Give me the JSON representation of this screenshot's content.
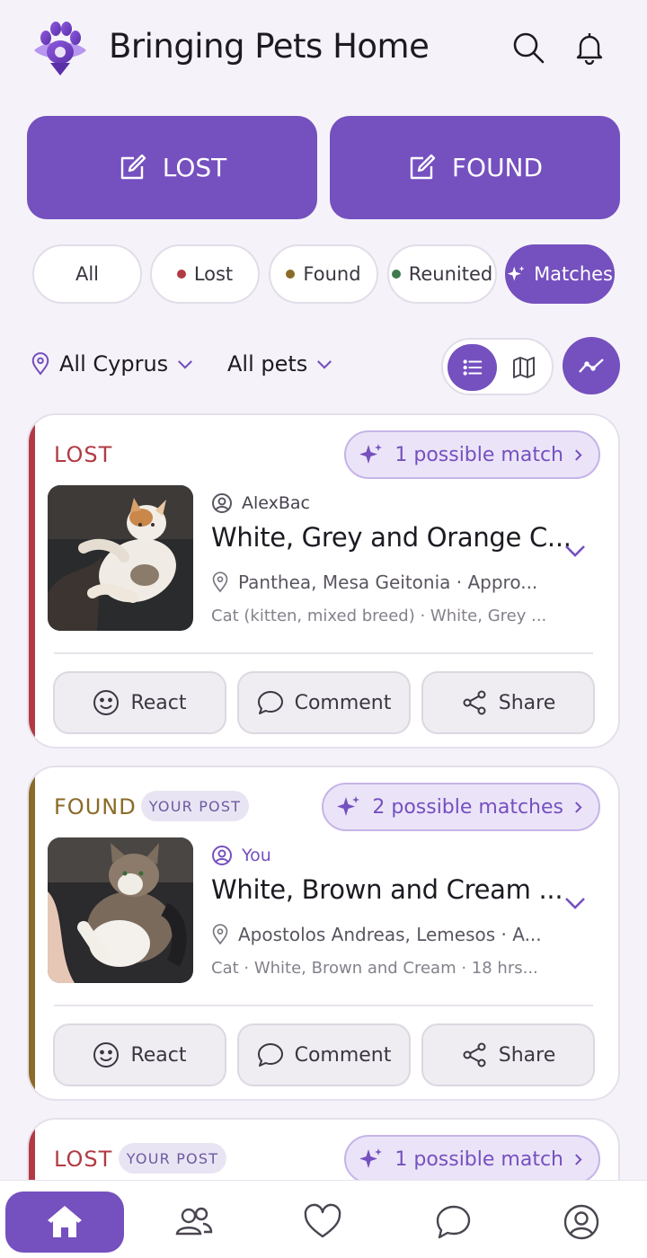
{
  "app": {
    "title": "Bringing Pets Home"
  },
  "header": {
    "icons": [
      "search-icon",
      "bell-icon"
    ]
  },
  "actions": {
    "lost_label": "LOST",
    "found_label": "FOUND"
  },
  "status_filters": [
    {
      "label": "All",
      "dot_color": null
    },
    {
      "label": "Lost",
      "dot_color": "#b23a44"
    },
    {
      "label": "Found",
      "dot_color": "#8a6b28"
    },
    {
      "label": "Reunited",
      "dot_color": "#3c7a4e"
    },
    {
      "label": "Matches",
      "dot_color": null,
      "active": true
    }
  ],
  "filters": {
    "location": "All Cyprus",
    "pets": "All pets",
    "view_mode": "list"
  },
  "colors": {
    "accent": "#7550bf",
    "lost": "#b23a44",
    "found": "#8a6b28"
  },
  "posts": [
    {
      "status": "LOST",
      "status_color": "#b23a44",
      "your_post": null,
      "matches": "1 possible match",
      "author": "AlexBac",
      "title": "White, Grey and Orange C...",
      "location": "Panthea, Mesa Geitonia · Appro...",
      "description": "Cat (kitten, mixed breed) · White, Grey ...",
      "actions": {
        "react": "React",
        "comment": "Comment",
        "share": "Share"
      }
    },
    {
      "status": "FOUND",
      "status_color": "#8a6b28",
      "your_post": "YOUR POST",
      "matches": "2 possible matches",
      "author": "You",
      "title": "White, Brown and Cream ...",
      "location": "Apostolos Andreas, Lemesos · A...",
      "description": "Cat · White, Brown and Cream  ·  18 hrs...",
      "actions": {
        "react": "React",
        "comment": "Comment",
        "share": "Share"
      }
    },
    {
      "status": "LOST",
      "status_color": "#b23a44",
      "your_post": "YOUR POST",
      "matches": "1 possible match"
    }
  ],
  "bottom_nav": [
    {
      "icon": "home-icon",
      "active": true
    },
    {
      "icon": "people-icon"
    },
    {
      "icon": "heart-icon"
    },
    {
      "icon": "chat-icon"
    },
    {
      "icon": "profile-icon"
    }
  ]
}
